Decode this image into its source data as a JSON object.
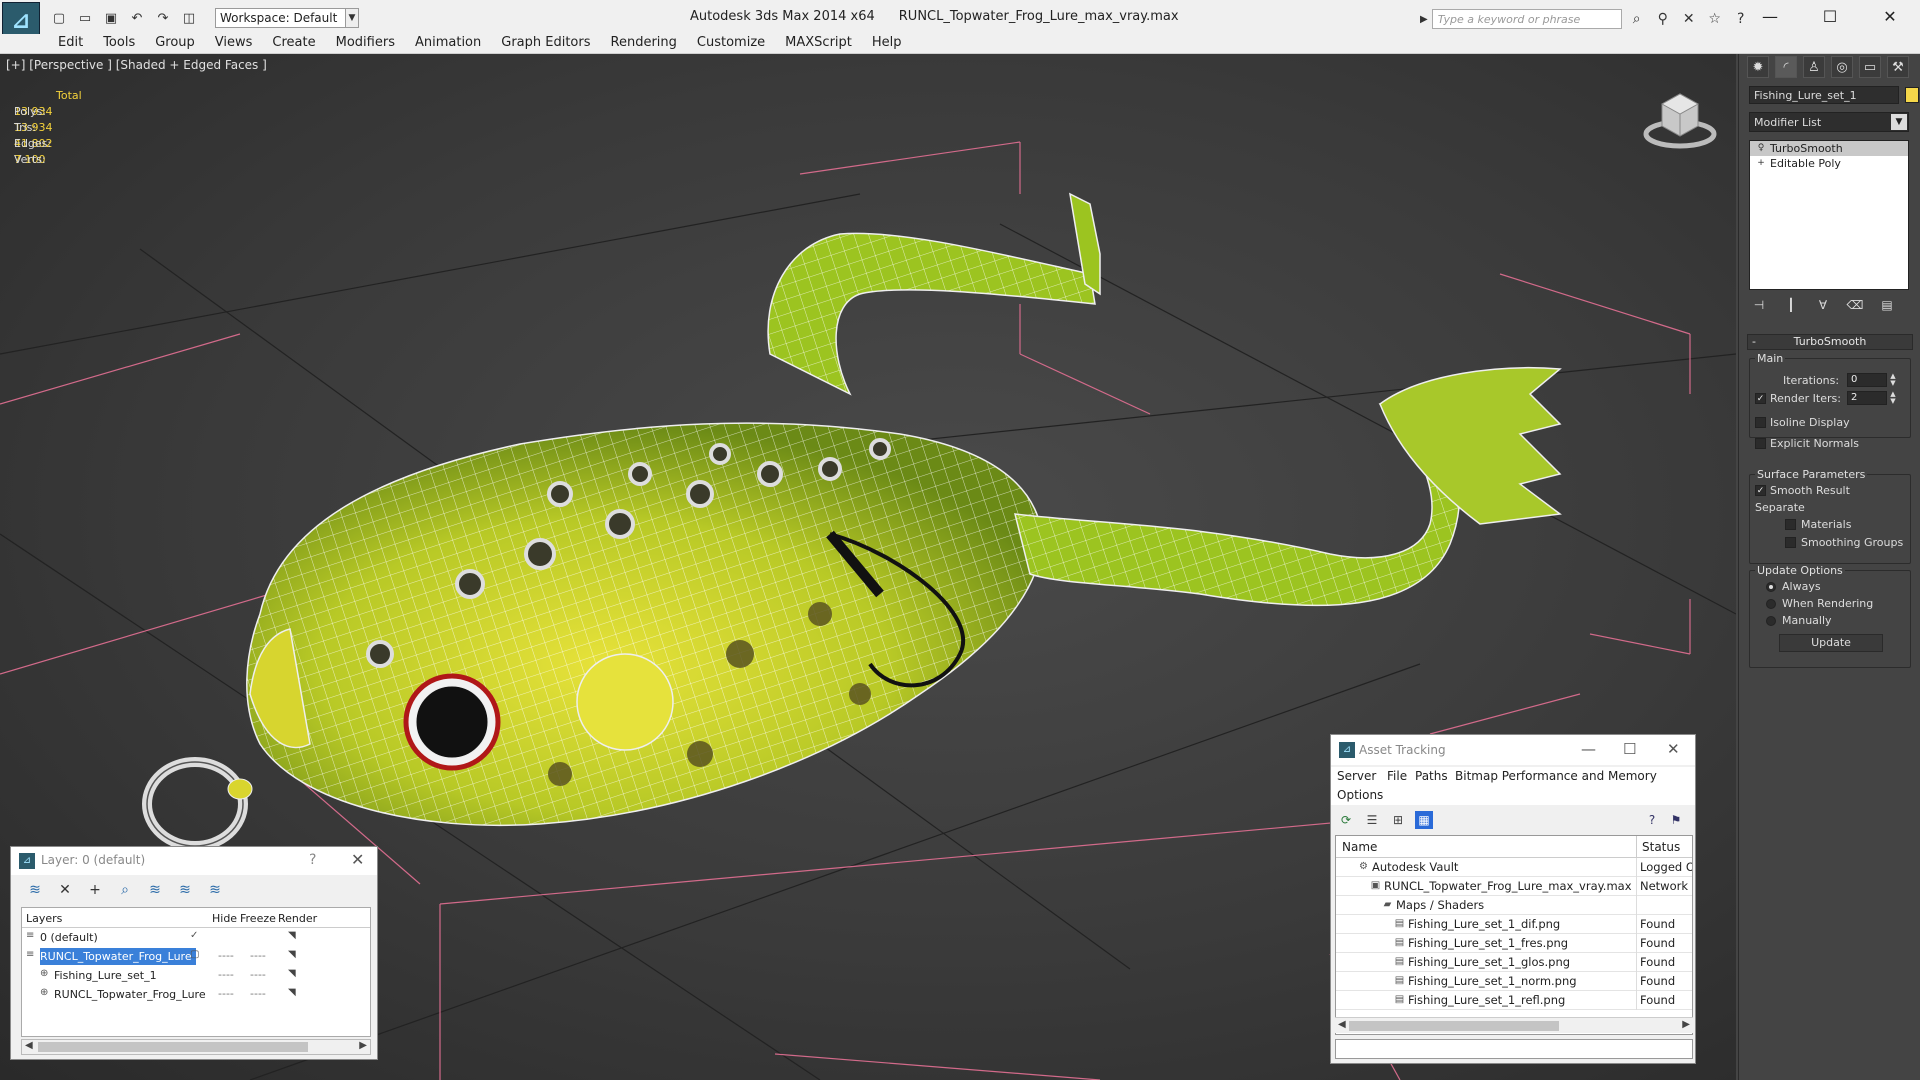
{
  "titlebar": {
    "workspace_label": "Workspace: Default",
    "app_name": "Autodesk 3ds Max  2014 x64",
    "file_name": "RUNCL_Topwater_Frog_Lure_max_vray.max",
    "search_placeholder": "Type a keyword or phrase"
  },
  "menu": [
    "Edit",
    "Tools",
    "Group",
    "Views",
    "Create",
    "Modifiers",
    "Animation",
    "Graph Editors",
    "Rendering",
    "Customize",
    "MAXScript",
    "Help"
  ],
  "viewport": {
    "label": "[+] [Perspective ] [Shaded + Edged Faces ]",
    "stats_header": "Total",
    "stats": [
      {
        "label": "Polys:",
        "value": "13 934"
      },
      {
        "label": "Tris:",
        "value": "13 934"
      },
      {
        "label": "Edges:",
        "value": "41 802"
      },
      {
        "label": "Verts:",
        "value": "7 100"
      }
    ]
  },
  "command_panel": {
    "object_name": "Fishing_Lure_set_1",
    "object_color": "#f5d74a",
    "modifier_list": "Modifier List",
    "stack": [
      "TurboSmooth",
      "Editable Poly"
    ],
    "rollout_title": "TurboSmooth",
    "main_group": "Main",
    "iterations_label": "Iterations:",
    "iterations_value": "0",
    "render_iters_label": "Render Iters:",
    "render_iters_value": "2",
    "isoline_label": "Isoline Display",
    "explicit_normals_label": "Explicit Normals",
    "surface_group": "Surface Parameters",
    "smooth_result_label": "Smooth Result",
    "separate_label": "Separate",
    "materials_label": "Materials",
    "smoothing_groups_label": "Smoothing Groups",
    "update_group": "Update Options",
    "always_label": "Always",
    "when_rendering_label": "When Rendering",
    "manually_label": "Manually",
    "update_button": "Update"
  },
  "layer_window": {
    "title": "Layer: 0 (default)",
    "help": "?",
    "columns": {
      "layers": "Layers",
      "hide": "Hide",
      "freeze": "Freeze",
      "render": "Render"
    },
    "rows": [
      {
        "name": "0 (default)",
        "indent": 0,
        "checked": true
      },
      {
        "name": "RUNCL_Topwater_Frog_Lure",
        "indent": 0,
        "selected": true
      },
      {
        "name": "Fishing_Lure_set_1",
        "indent": 1
      },
      {
        "name": "RUNCL_Topwater_Frog_Lure",
        "indent": 1
      }
    ],
    "dash": "----"
  },
  "asset_window": {
    "title": "Asset Tracking",
    "menu": [
      "Server",
      "File",
      "Paths",
      "Bitmap Performance and Memory",
      "Options"
    ],
    "columns": {
      "name": "Name",
      "status": "Status"
    },
    "rows": [
      {
        "name": "Autodesk Vault",
        "status": "Logged O",
        "indent": 1
      },
      {
        "name": "RUNCL_Topwater_Frog_Lure_max_vray.max",
        "status": "Network P",
        "indent": 2
      },
      {
        "name": "Maps / Shaders",
        "status": "",
        "indent": 3
      },
      {
        "name": "Fishing_Lure_set_1_dif.png",
        "status": "Found",
        "indent": 4
      },
      {
        "name": "Fishing_Lure_set_1_fres.png",
        "status": "Found",
        "indent": 4
      },
      {
        "name": "Fishing_Lure_set_1_glos.png",
        "status": "Found",
        "indent": 4
      },
      {
        "name": "Fishing_Lure_set_1_norm.png",
        "status": "Found",
        "indent": 4
      },
      {
        "name": "Fishing_Lure_set_1_refl.png",
        "status": "Found",
        "indent": 4
      }
    ]
  }
}
